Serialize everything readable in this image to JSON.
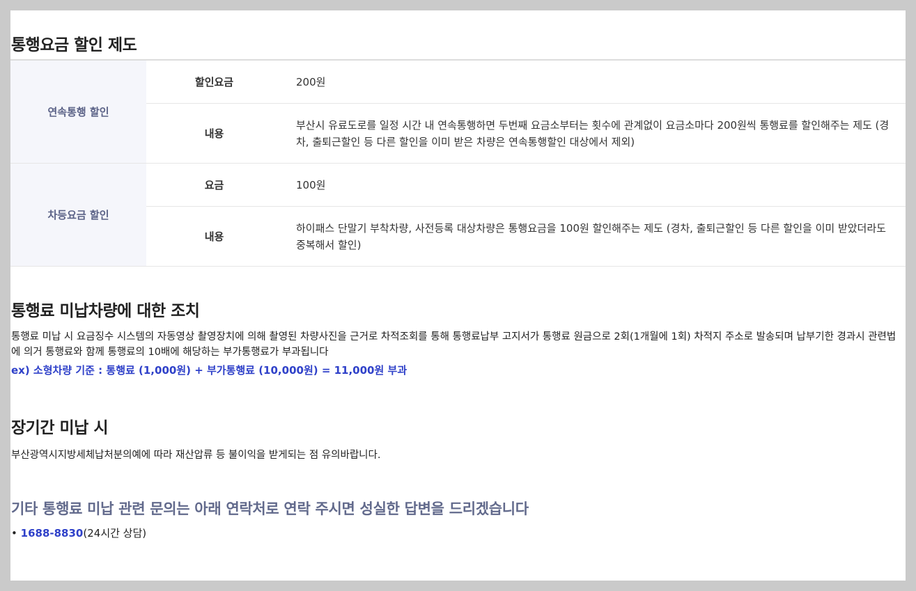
{
  "discount": {
    "title": "통행요금 할인 제도",
    "groups": [
      {
        "name": "연속통행 할인",
        "rows": [
          {
            "label": "할인요금",
            "value": "200원"
          },
          {
            "label": "내용",
            "value": "부산시 유료도로를 일정 시간 내 연속통행하면 두번째 요금소부터는 횟수에 관계없이 요금소마다 200원씩 통행료를 할인해주는 제도 (경차, 출퇴근할인 등 다른 할인을 이미 받은 차량은 연속통행할인 대상에서 제외)"
          }
        ]
      },
      {
        "name": "차등요금 할인",
        "rows": [
          {
            "label": "요금",
            "value": "100원"
          },
          {
            "label": "내용",
            "value": "하이패스 단말기 부착차량, 사전등록 대상차량은 통행요금을 100원 할인해주는 제도 (경차, 출퇴근할인 등 다른 할인을 이미 받았더라도 중복해서 할인)"
          }
        ]
      }
    ]
  },
  "unpaid": {
    "title": "통행료 미납차량에 대한 조치",
    "description": "통행료 미납 시 요금징수 시스템의 자동영상 촬영장치에 의해 촬영된 차량사진을 근거로 차적조회를 통해 통행료납부 고지서가 통행료 원금으로 2회(1개월에 1회) 차적지 주소로 발송되며 납부기한 경과시 관련법에 의거 통행료와 함께 통행료의 10배에 해당하는 부가통행료가 부과됩니다",
    "example": "ex) 소형차량 기준 : 통행료 (1,000원) + 부가통행료 (10,000원) = 11,000원 부과"
  },
  "longterm": {
    "title": "장기간 미납 시",
    "description": "부산광역시지방세체납처분의예에 따라 재산압류 등 불이익을 받게되는 점 유의바랍니다."
  },
  "contact": {
    "title": "기타 통행료 미납 관련 문의는 아래 연락처로 연락 주시면 성실한 답변을 드리겠습니다",
    "bullet": "•",
    "phone": "1688-8830",
    "note": "(24시간 상담)"
  },
  "colors": {
    "accent": "#2f41c9",
    "group_bg": "#f5f6fb",
    "group_text": "#5b6287",
    "frame": "#cacaca"
  }
}
